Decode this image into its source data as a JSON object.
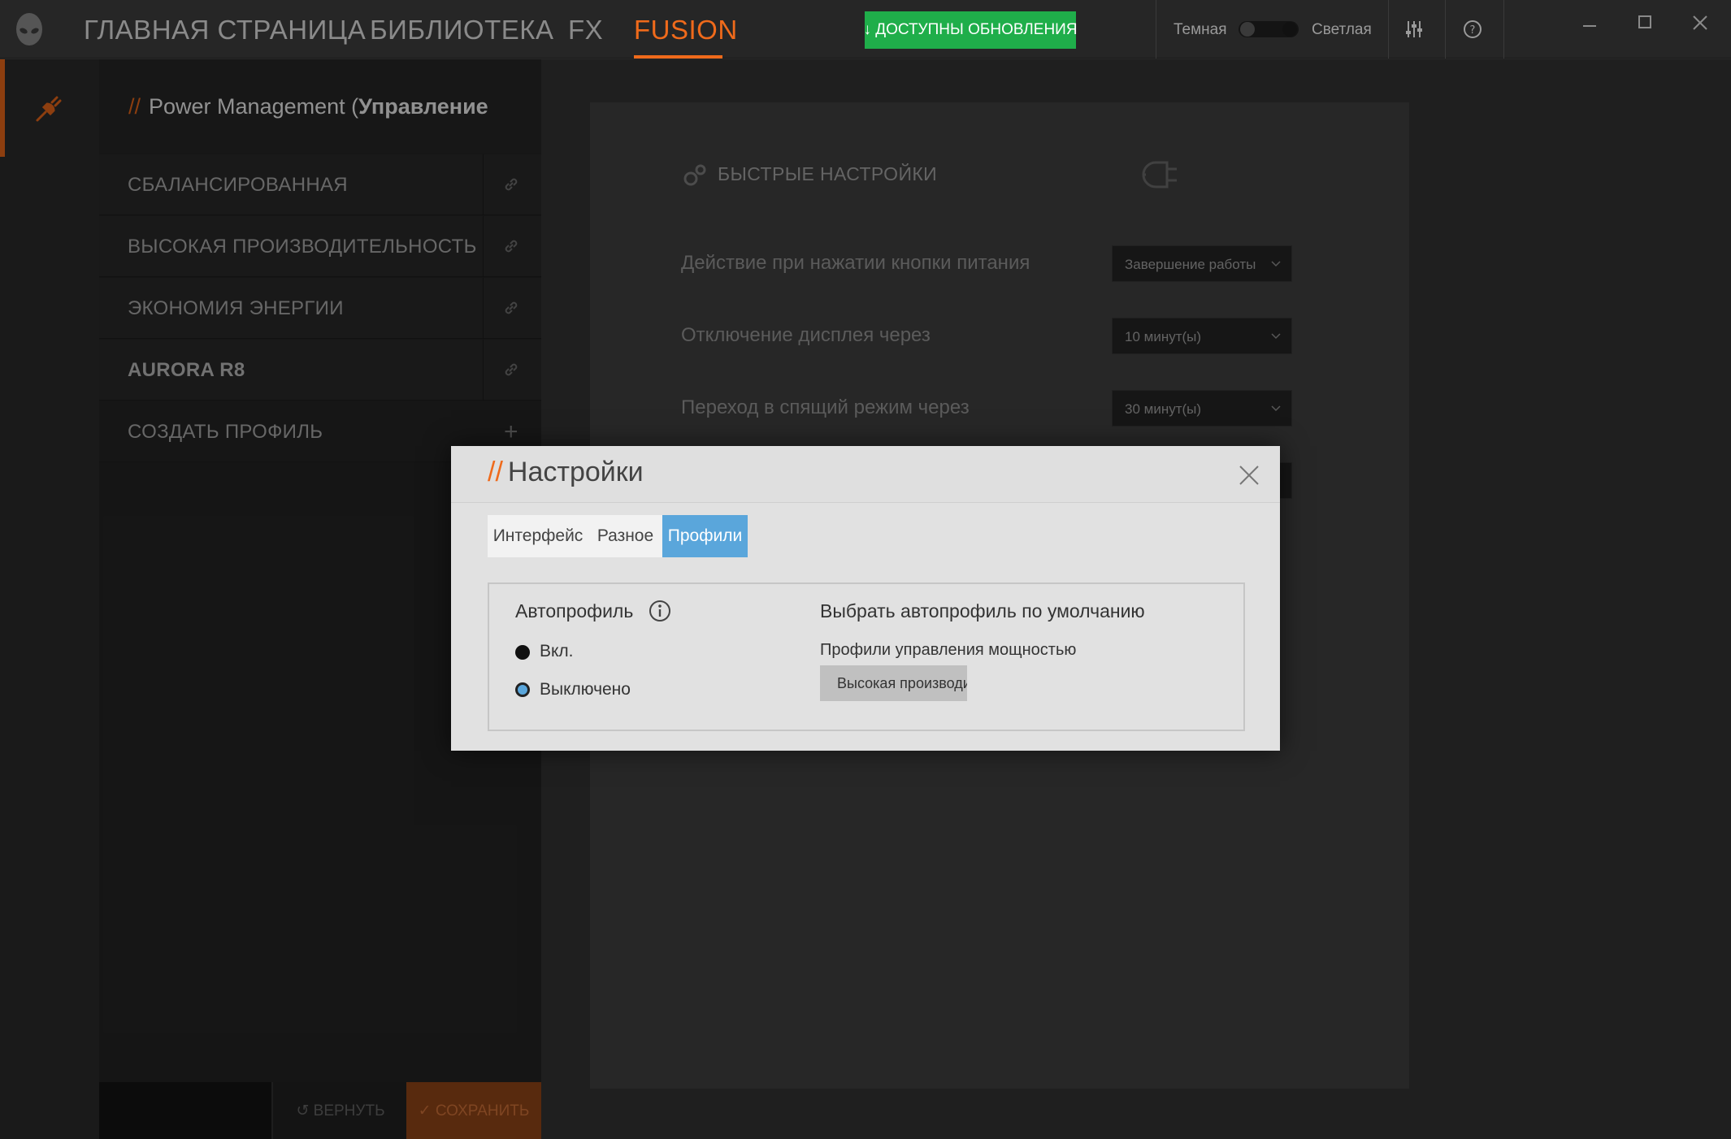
{
  "nav": {
    "items": [
      "ГЛАВНАЯ СТРАНИЦА",
      "БИБЛИОТЕКА",
      "FX",
      "FUSION"
    ],
    "active": "FUSION",
    "update_button": "↓ ДОСТУПНЫ ОБНОВЛЕНИЯ",
    "theme_dark": "Темная",
    "theme_light": "Светлая"
  },
  "sidebar": {
    "title_prefix": "//",
    "title": "Power Management (",
    "title_bold": "Управление эн",
    "profiles": [
      {
        "label": "СБАЛАНСИРОВАННАЯ"
      },
      {
        "label": "ВЫСОКАЯ ПРОИЗВОДИТЕЛЬНОСТЬ"
      },
      {
        "label": "ЭКОНОМИЯ ЭНЕРГИИ"
      },
      {
        "label": "AURORA R8"
      },
      {
        "label": "СОЗДАТЬ ПРОФИЛЬ"
      }
    ],
    "revert_button": "↺ ВЕРНУТЬ",
    "save_button": "✓ СОХРАНИТЬ"
  },
  "quick_settings": {
    "title": "БЫСТРЫЕ НАСТРОЙКИ",
    "settings": [
      {
        "label": "Действие при нажатии кнопки питания",
        "value": "Завершение работы"
      },
      {
        "label": "Отключение дисплея через",
        "value": "10 минут(ы)"
      },
      {
        "label": "Переход в спящий режим через",
        "value": "30 минут(ы)"
      }
    ]
  },
  "modal": {
    "title_prefix": "//",
    "title": "Настройки",
    "tabs": [
      "Интерфейс",
      "Разное",
      "Профили"
    ],
    "active_tab": "Профили",
    "autoprofile_label": "Автопрофиль",
    "radio_on_label": "Вкл.",
    "radio_off_label": "Выключено",
    "default_title": "Выбрать автопрофиль по умолчанию",
    "power_profiles_label": "Профили управления мощностью",
    "selected_profile": "Высокая производительность"
  },
  "colors": {
    "accent": "#ef6a1b",
    "update_green": "#1fae4a",
    "tab_active": "#5aa6db"
  }
}
